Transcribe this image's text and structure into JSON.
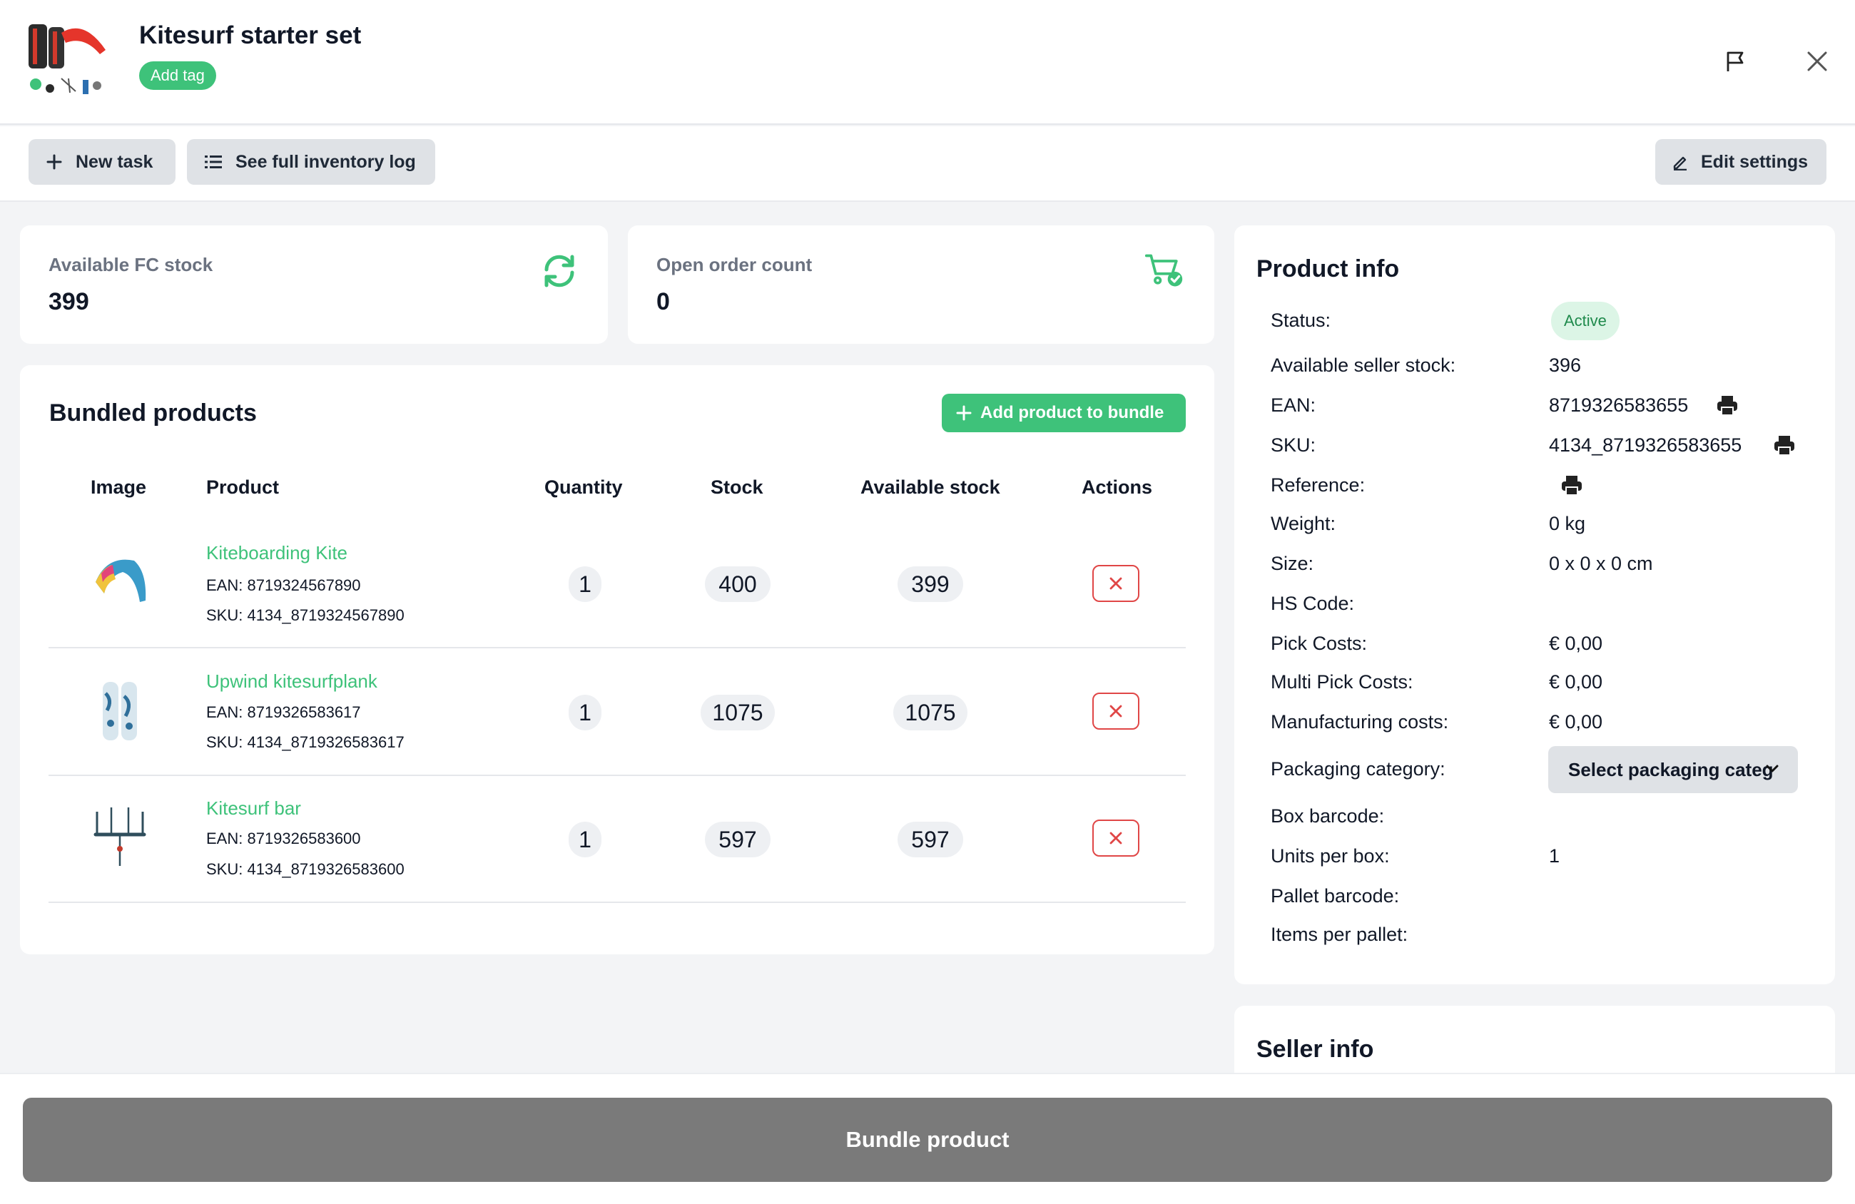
{
  "header": {
    "title": "Kitesurf starter set",
    "add_tag": "Add tag"
  },
  "toolbar": {
    "new_task": "New task",
    "inventory_log": "See full inventory log",
    "edit_settings": "Edit settings"
  },
  "stats": {
    "fc_stock": {
      "label": "Available FC stock",
      "value": "399"
    },
    "open_orders": {
      "label": "Open order count",
      "value": "0"
    }
  },
  "bundle": {
    "title": "Bundled products",
    "add_button": "Add product to bundle",
    "columns": [
      "Image",
      "Product",
      "Quantity",
      "Stock",
      "Available stock",
      "Actions"
    ],
    "rows": [
      {
        "name": "Kiteboarding Kite",
        "ean": "EAN: 8719324567890",
        "sku": "SKU: 4134_8719324567890",
        "quantity": "1",
        "stock": "400",
        "available": "399"
      },
      {
        "name": "Upwind kitesurfplank",
        "ean": "EAN: 8719326583617",
        "sku": "SKU: 4134_8719326583617",
        "quantity": "1",
        "stock": "1075",
        "available": "1075"
      },
      {
        "name": "Kitesurf bar",
        "ean": "EAN: 8719326583600",
        "sku": "SKU: 4134_8719326583600",
        "quantity": "1",
        "stock": "597",
        "available": "597"
      }
    ]
  },
  "product_info": {
    "title": "Product info",
    "status_label": "Status:",
    "status": "Active",
    "seller_stock_label": "Available seller stock:",
    "seller_stock": "396",
    "ean_label": "EAN:",
    "ean": "8719326583655",
    "sku_label": "SKU:",
    "sku": "4134_8719326583655",
    "reference_label": "Reference:",
    "weight_label": "Weight:",
    "weight": "0 kg",
    "size_label": "Size:",
    "size": "0 x 0 x 0 cm",
    "hs_label": "HS Code:",
    "pick_label": "Pick Costs:",
    "pick": "€ 0,00",
    "multi_pick_label": "Multi Pick Costs:",
    "multi_pick": "€ 0,00",
    "manufacturing_label": "Manufacturing costs:",
    "manufacturing": "€ 0,00",
    "packaging_label": "Packaging category:",
    "packaging_placeholder": "Select packaging categ",
    "box_barcode_label": "Box barcode:",
    "units_label": "Units per box:",
    "units": "1",
    "pallet_barcode_label": "Pallet barcode:",
    "items_pallet_label": "Items per pallet:"
  },
  "seller_info": {
    "title": "Seller info"
  },
  "footer": {
    "bundle_button": "Bundle product"
  },
  "colors": {
    "accent": "#3ec27a",
    "danger": "#e04646",
    "button_gray": "#dfe2e6",
    "footer_button": "#7a7a7a"
  }
}
